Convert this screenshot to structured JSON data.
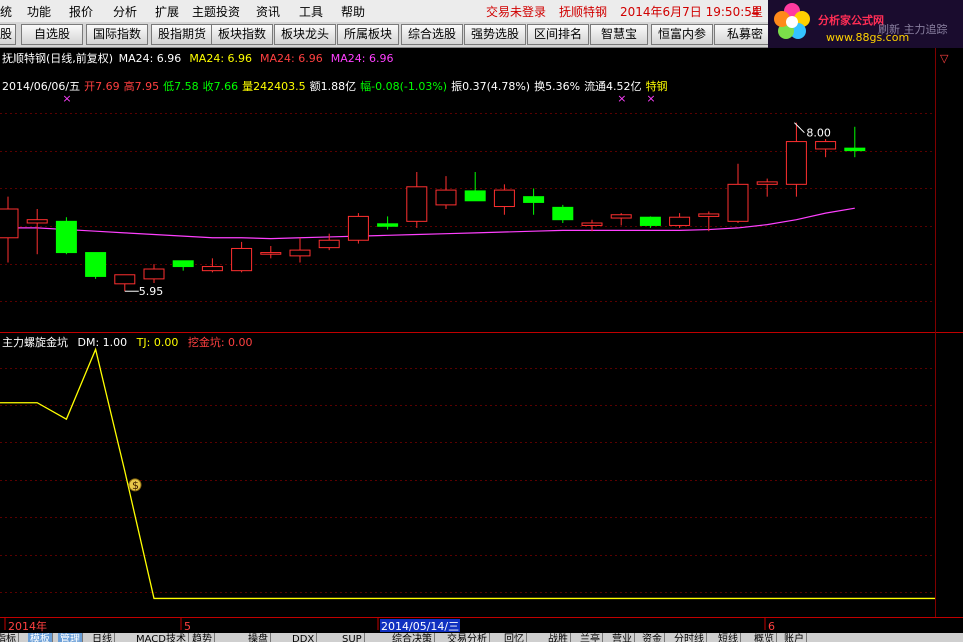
{
  "menubar": {
    "items": [
      "统",
      "功能",
      "报价",
      "分析",
      "扩展",
      "主题投资",
      "资讯",
      "工具",
      "帮助"
    ],
    "trade_status": "交易未登录",
    "stock_name": "抚顺特钢",
    "datetime": "2014年6月7日 19:50:54",
    "trailing_char": "星"
  },
  "toolbar": {
    "buttons": [
      "股",
      "自选股",
      "国际指数",
      "股指期货",
      "板块指数",
      "板块龙头",
      "所属板块",
      "综合选股",
      "强势选股",
      "区间排名",
      "智慧宝",
      "恒富内参",
      "私募密"
    ]
  },
  "logo": {
    "title": "分析家公式网",
    "url": "www.88gs.com",
    "overlay_text": "刷新 主力追踪"
  },
  "main_panel": {
    "title_prefix": "抚顺特钢(日线,前复权)",
    "ma_items": [
      {
        "text": "MA24: 6.96",
        "color": "#ffffff"
      },
      {
        "text": "MA24: 6.96",
        "color": "#ffff00"
      },
      {
        "text": "MA24: 6.96",
        "color": "#ff4040"
      },
      {
        "text": "MA24: 6.96",
        "color": "#ff40ff"
      }
    ],
    "info_row": [
      {
        "text": "2014/06/06/五",
        "color": "#ffffff"
      },
      {
        "text": "开7.69",
        "color": "#ff4040"
      },
      {
        "text": "高7.95",
        "color": "#ff4040"
      },
      {
        "text": "低7.58",
        "color": "#00ff00"
      },
      {
        "text": "收7.66",
        "color": "#00ff00"
      },
      {
        "text": "量242403.5",
        "color": "#ffff00"
      },
      {
        "text": "额1.88亿",
        "color": "#ffffff"
      },
      {
        "text": "幅-0.08(-1.03%)",
        "color": "#00ff00"
      },
      {
        "text": "振0.37(4.78%)",
        "color": "#ffffff"
      },
      {
        "text": "换5.36%",
        "color": "#ffffff"
      },
      {
        "text": "流通4.52亿",
        "color": "#ffffff"
      },
      {
        "text": "特钢",
        "color": "#ffff00"
      }
    ],
    "high_label": "8.00",
    "low_label": "5.95",
    "flag_marker": "×",
    "corner_mark": "▽"
  },
  "sub_panel": {
    "title": "主力螺旋金坑",
    "dm": "DM: 1.00",
    "tj": "TJ: 0.00",
    "wjk": "挖金坑: 0.00",
    "money_bag": "$"
  },
  "x_axis": {
    "labels": [
      "2014年",
      "5",
      "2014/05/14/三",
      "6"
    ]
  },
  "tabbar": {
    "tabs": [
      "指标",
      "模板",
      "管理",
      "日线",
      "MACD技术",
      "趋势",
      "操盘",
      "DDX",
      "SUP",
      "综合决策",
      "交易分析",
      "回忆",
      "战胜",
      "兰亭",
      "营业",
      "资金",
      "分时线",
      "短线",
      "概览",
      "账户"
    ]
  },
  "chart_data": {
    "type": "candlestick",
    "ylim": [
      5.6,
      8.3
    ],
    "candles": [
      {
        "o": 6.6,
        "h": 7.1,
        "l": 6.3,
        "c": 6.95
      },
      {
        "o": 6.78,
        "h": 6.95,
        "l": 6.4,
        "c": 6.82
      },
      {
        "o": 6.8,
        "h": 6.85,
        "l": 6.4,
        "c": 6.42
      },
      {
        "o": 6.42,
        "h": 6.42,
        "l": 6.1,
        "c": 6.13
      },
      {
        "o": 6.04,
        "h": 6.15,
        "l": 5.95,
        "c": 6.15
      },
      {
        "o": 6.1,
        "h": 6.28,
        "l": 6.05,
        "c": 6.22
      },
      {
        "o": 6.32,
        "h": 6.32,
        "l": 6.2,
        "c": 6.25
      },
      {
        "o": 6.2,
        "h": 6.35,
        "l": 6.18,
        "c": 6.25
      },
      {
        "o": 6.2,
        "h": 6.55,
        "l": 6.18,
        "c": 6.47
      },
      {
        "o": 6.4,
        "h": 6.5,
        "l": 6.35,
        "c": 6.42
      },
      {
        "o": 6.38,
        "h": 6.6,
        "l": 6.3,
        "c": 6.45
      },
      {
        "o": 6.48,
        "h": 6.65,
        "l": 6.45,
        "c": 6.57
      },
      {
        "o": 6.57,
        "h": 6.9,
        "l": 6.53,
        "c": 6.86
      },
      {
        "o": 6.77,
        "h": 6.86,
        "l": 6.7,
        "c": 6.74
      },
      {
        "o": 6.8,
        "h": 7.4,
        "l": 6.72,
        "c": 7.22
      },
      {
        "o": 7.0,
        "h": 7.35,
        "l": 6.95,
        "c": 7.18
      },
      {
        "o": 7.17,
        "h": 7.4,
        "l": 7.05,
        "c": 7.05
      },
      {
        "o": 6.98,
        "h": 7.25,
        "l": 6.88,
        "c": 7.18
      },
      {
        "o": 7.1,
        "h": 7.2,
        "l": 6.88,
        "c": 7.03
      },
      {
        "o": 6.97,
        "h": 7.0,
        "l": 6.78,
        "c": 6.82
      },
      {
        "o": 6.75,
        "h": 6.82,
        "l": 6.68,
        "c": 6.78
      },
      {
        "o": 6.84,
        "h": 6.9,
        "l": 6.75,
        "c": 6.88
      },
      {
        "o": 6.85,
        "h": 6.86,
        "l": 6.72,
        "c": 6.75
      },
      {
        "o": 6.75,
        "h": 6.9,
        "l": 6.72,
        "c": 6.85
      },
      {
        "o": 6.86,
        "h": 6.92,
        "l": 6.68,
        "c": 6.89
      },
      {
        "o": 6.8,
        "h": 7.5,
        "l": 6.78,
        "c": 7.25
      },
      {
        "o": 7.25,
        "h": 7.32,
        "l": 7.1,
        "c": 7.28
      },
      {
        "o": 7.25,
        "h": 8.0,
        "l": 7.1,
        "c": 7.77
      },
      {
        "o": 7.68,
        "h": 7.8,
        "l": 7.58,
        "c": 7.77
      },
      {
        "o": 7.69,
        "h": 7.95,
        "l": 7.58,
        "c": 7.66
      }
    ],
    "ma24": [
      6.72,
      6.72,
      6.7,
      6.68,
      6.66,
      6.64,
      6.62,
      6.6,
      6.6,
      6.59,
      6.6,
      6.61,
      6.62,
      6.63,
      6.64,
      6.65,
      6.66,
      6.67,
      6.68,
      6.69,
      6.69,
      6.69,
      6.69,
      6.69,
      6.7,
      6.72,
      6.76,
      6.82,
      6.9,
      6.96
    ],
    "indicator": {
      "ylim": [
        0,
        1.9
      ],
      "values": [
        1.5,
        1.5,
        1.38,
        1.89,
        1.0,
        0.07,
        0.07,
        0.07,
        0.07,
        0.07,
        0.07,
        0.07,
        0.07,
        0.07,
        0.07,
        0.07,
        0.07,
        0.07,
        0.07,
        0.07,
        0.07,
        0.07,
        0.07,
        0.07,
        0.07,
        0.07,
        0.07,
        0.07,
        0.07,
        0.07
      ],
      "marker_value": 0.9
    }
  }
}
